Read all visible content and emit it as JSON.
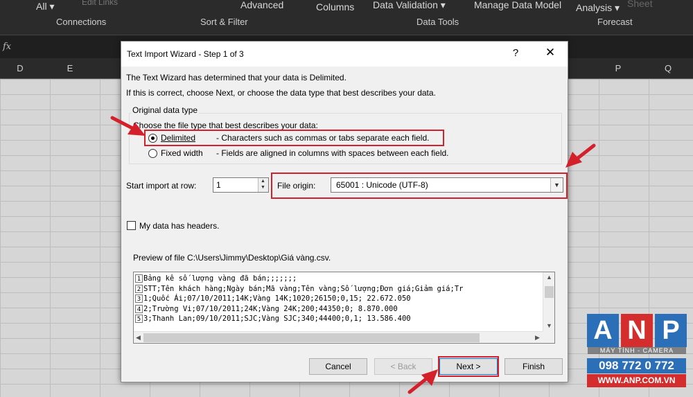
{
  "ribbon": {
    "all_label": "All",
    "edit_links_label": "Edit Links",
    "advanced_label": "Advanced",
    "columns_label": "Columns",
    "data_validation_label": "Data Validation",
    "manage_data_model_label": "Manage Data Model",
    "analysis_label": "Analysis",
    "sheet_label": "Sheet",
    "groups": [
      "Connections",
      "Sort & Filter",
      "Data Tools",
      "Forecast"
    ]
  },
  "formula_bar": {
    "fx_label": "fx"
  },
  "columns": [
    "D",
    "E",
    "P",
    "Q"
  ],
  "dialog": {
    "title": "Text Import Wizard - Step 1 of 3",
    "help": "?",
    "close": "✕",
    "intro_line1": "The Text Wizard has determined that your data is Delimited.",
    "intro_line2": "If this is correct, choose Next, or choose the data type that best describes your data.",
    "group_title": "Original data type",
    "choose_label": "Choose the file type that best describes your data:",
    "options": [
      {
        "label": "Delimited",
        "description": "- Characters such as commas or tabs separate each field.",
        "selected": true
      },
      {
        "label": "Fixed width",
        "description": "- Fields are aligned in columns with spaces between each field.",
        "selected": false
      }
    ],
    "start_row_label": "Start import at row:",
    "start_row_value": "1",
    "file_origin_label": "File origin:",
    "file_origin_value": "65001 : Unicode (UTF-8)",
    "headers_label": "My data has headers.",
    "headers_checked": false,
    "preview_label": "Preview of file C:\\Users\\Jimmy\\Desktop\\Giá vàng.csv.",
    "preview_lines": [
      {
        "num": "1",
        "text": "Bảng kê số lượng vàng đã bán;;;;;;;"
      },
      {
        "num": "2",
        "text": "STT;Tên khách hàng;Ngày bán;Mã vàng;Tên vàng;Số lượng;Đơn giá;Giảm giá;Tr"
      },
      {
        "num": "3",
        "text": "1;Quốc Ái;07/10/2011;14K;Vàng 14K;1020;26150;0,15; 22.672.050"
      },
      {
        "num": "4",
        "text": "2;Trường Vi;07/10/2011;24K;Vàng 24K;200;44350;0; 8.870.000"
      },
      {
        "num": "5",
        "text": "3;Thanh Lan;09/10/2011;SJC;Vàng SJC;340;44400;0,1; 13.586.400"
      }
    ],
    "buttons": {
      "cancel": "Cancel",
      "back": "< Back",
      "next": "Next >",
      "finish": "Finish"
    }
  },
  "watermark": {
    "letters": [
      "A",
      "N",
      "P"
    ],
    "subtitle": "MÁY TÍNH - CAMERA",
    "phone": "098 772 0 772",
    "website": "WWW.ANP.COM.VN"
  },
  "colors": {
    "highlight": "#d4202a",
    "ribbon": "#2b2b2b",
    "dialog": "#f0f0f0",
    "logo_blue": "#2a6fb8",
    "logo_red": "#d32d2d"
  }
}
